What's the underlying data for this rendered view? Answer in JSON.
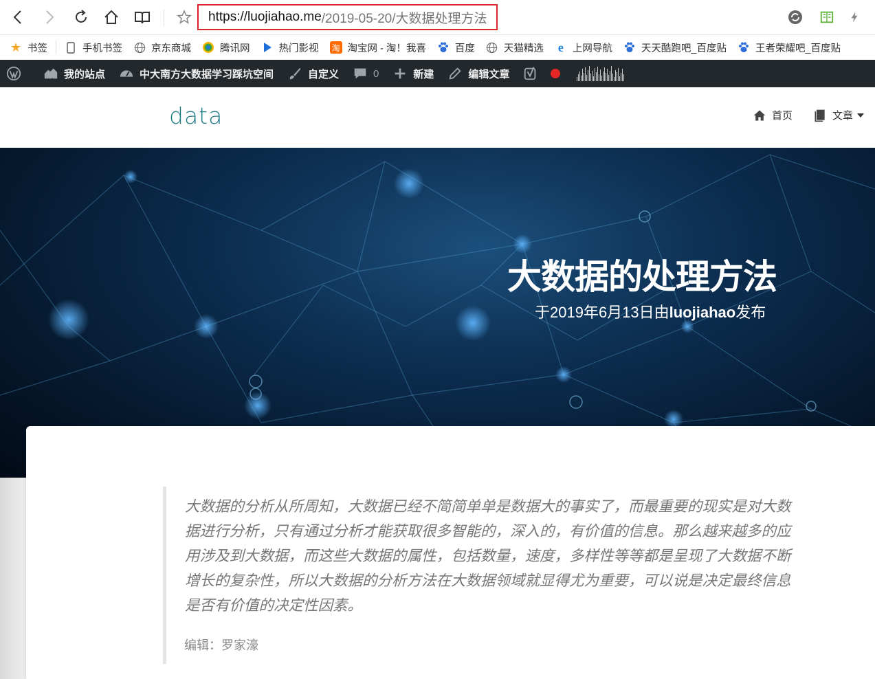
{
  "browser": {
    "url_host": "https://luojiahao.me",
    "url_path": "/2019-05-20/大数据处理方法"
  },
  "bookmarks": [
    {
      "label": "书签",
      "icon": "star-icon"
    },
    {
      "label": "手机书签",
      "icon": "phone-icon"
    },
    {
      "label": "京东商城",
      "icon": "globe-icon"
    },
    {
      "label": "腾讯网",
      "icon": "tencent-icon"
    },
    {
      "label": "热门影视",
      "icon": "play-icon"
    },
    {
      "label": "淘宝网 - 淘！我喜",
      "icon": "taobao-icon"
    },
    {
      "label": "百度",
      "icon": "baidu-paw-icon"
    },
    {
      "label": "天猫精选",
      "icon": "globe-icon"
    },
    {
      "label": "上网导航",
      "icon": "ie-icon"
    },
    {
      "label": "天天酷跑吧_百度贴",
      "icon": "baidu-paw-icon"
    },
    {
      "label": "王者荣耀吧_百度贴",
      "icon": "baidu-paw-icon"
    }
  ],
  "adminbar": {
    "my_sites": "我的站点",
    "site_name": "中大南方大数据学习踩坑空间",
    "customize": "自定义",
    "comments_count": "0",
    "new": "新建",
    "edit_post": "编辑文章"
  },
  "site": {
    "logo": "data",
    "nav_home": "首页",
    "nav_posts": "文章"
  },
  "post": {
    "title": "大数据的处理方法",
    "meta_prefix": "于2019年6月13日由",
    "meta_author": "luojiahao",
    "meta_suffix": "发布",
    "quote": "大数据的分析从所周知，大数据已经不简简单单是数据大的事实了，而最重要的现实是对大数据进行分析，只有通过分析才能获取很多智能的，深入的，有价值的信息。那么越来越多的应用涉及到大数据，而这些大数据的属性，包括数量，速度，多样性等等都是呈现了大数据不断增长的复杂性，所以大数据的分析方法在大数据领域就显得尤为重要，可以说是决定最终信息是否有价值的决定性因素。",
    "editor": "编辑：罗家濠"
  },
  "colors": {
    "accent": "#1e7a87",
    "adminbar": "#23282d",
    "url_border": "#d8262b",
    "record": "#e32727"
  }
}
